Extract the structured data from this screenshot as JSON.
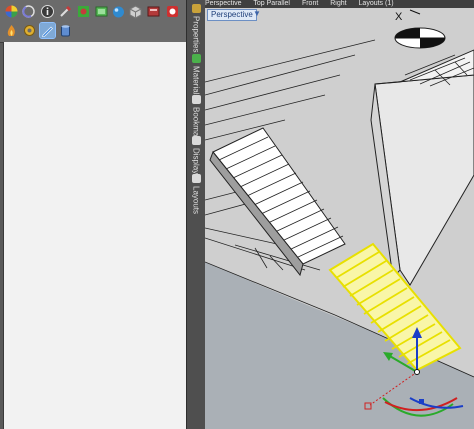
{
  "toolbar": {
    "icons": [
      {
        "name": "color-wheel-icon",
        "color": "#d94f2b"
      },
      {
        "name": "moon-icon",
        "color": "#7b7bd6"
      },
      {
        "name": "info-icon",
        "color": "#e6e6e6"
      },
      {
        "name": "tools-icon",
        "color": "#c43c3c"
      },
      {
        "name": "sun-icon",
        "color": "#3aaa3a"
      },
      {
        "name": "layers-icon",
        "color": "#56b856"
      },
      {
        "name": "material-ball-icon",
        "color": "#2f8ad0"
      },
      {
        "name": "cube-icon",
        "color": "#d0d0d0"
      },
      {
        "name": "render-icon",
        "color": "#b33a3a"
      },
      {
        "name": "object-icon",
        "color": "#ce3030"
      },
      {
        "name": "fire-icon",
        "color": "#e3902a"
      },
      {
        "name": "sprocket-icon",
        "color": "#e0b030"
      },
      {
        "name": "pencil-icon",
        "color": "#4a8ee0"
      },
      {
        "name": "can-icon",
        "color": "#5e8cd0"
      }
    ]
  },
  "side_tabs": [
    {
      "label": "Properties",
      "icon": "properties-icon",
      "color": "#c9a23a"
    },
    {
      "label": "Materials",
      "icon": "materials-icon",
      "color": "#4bb14b"
    },
    {
      "label": "Bookmark",
      "icon": "bookmark-icon",
      "color": "#d9d9d9"
    },
    {
      "label": "Display",
      "icon": "display-icon",
      "color": "#d9d9d9"
    },
    {
      "label": "Layouts",
      "icon": "layouts-icon",
      "color": "#d9d9d9"
    }
  ],
  "viewport": {
    "tabs": [
      "Perspective",
      "Top Parallel",
      "Front",
      "Right",
      "Layouts (1)"
    ],
    "active_label": "Perspective",
    "compass_label": "X",
    "selection_color": "#f5f000"
  }
}
